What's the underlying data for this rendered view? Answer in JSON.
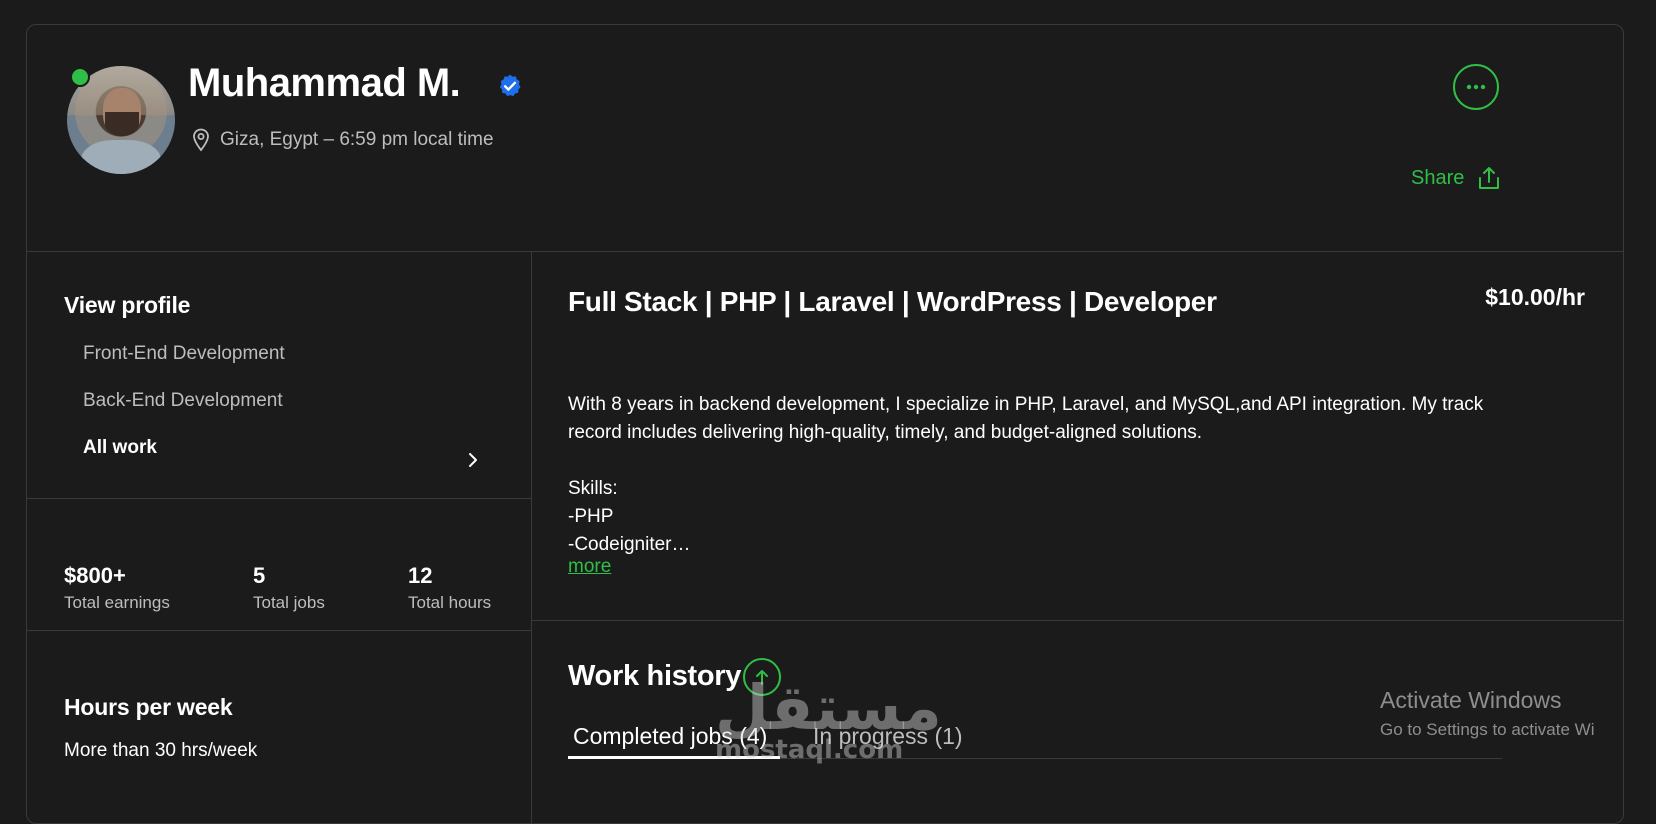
{
  "profile": {
    "name": "Muhammad M.",
    "location": "Giza, Egypt – 6:59 pm local time",
    "share_label": "Share"
  },
  "sidebar": {
    "title": "View profile",
    "items": [
      {
        "label": "Front-End Development"
      },
      {
        "label": "Back-End Development"
      },
      {
        "label": "All work"
      }
    ]
  },
  "stats": [
    {
      "value": "$800+",
      "label": "Total earnings"
    },
    {
      "value": "5",
      "label": "Total jobs"
    },
    {
      "value": "12",
      "label": "Total hours"
    }
  ],
  "hours": {
    "title": "Hours per week",
    "value": "More than 30 hrs/week"
  },
  "main": {
    "headline": "Full Stack | PHP | Laravel | WordPress | Developer",
    "rate": "$10.00/hr",
    "description": [
      "With 8 years in backend development, I specialize in PHP, Laravel, and MySQL,and API integration. My track record includes delivering high-quality, timely, and budget-aligned solutions.",
      "Skills:",
      "-PHP",
      "-Codeigniter…"
    ],
    "more_link": "more"
  },
  "work_history": {
    "title": "Work history",
    "tabs": [
      {
        "label": "Completed jobs (4)"
      },
      {
        "label": "In progress (1)"
      }
    ]
  },
  "watermark": {
    "text": "مستقل",
    "subtext": "mostaql.com"
  },
  "windows_notice": {
    "title": "Activate Windows",
    "subtitle": "Go to Settings to activate Wi"
  },
  "colors": {
    "accent": "#2fbf47",
    "verified": "#1f6feb",
    "background": "#1b1b1b"
  }
}
